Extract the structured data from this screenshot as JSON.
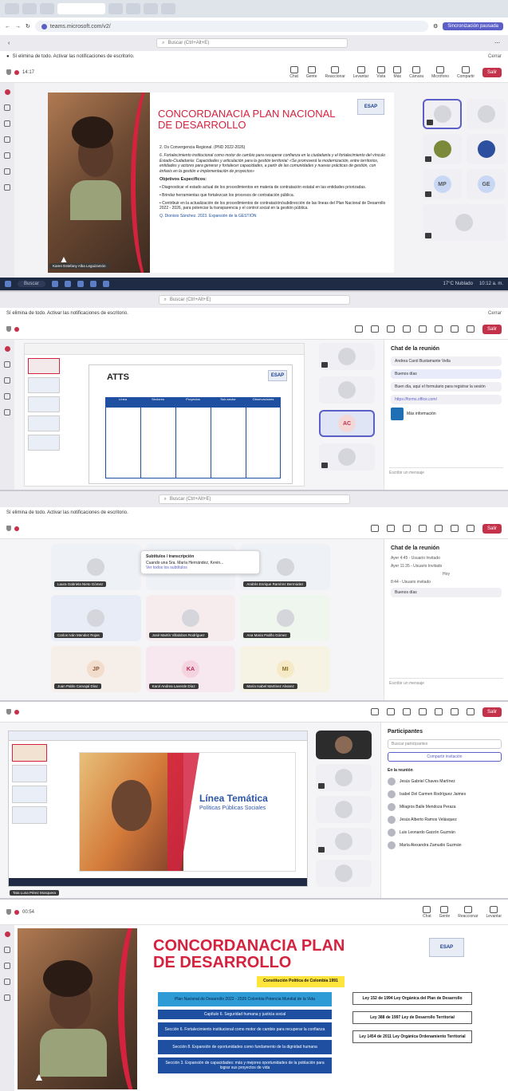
{
  "panel1": {
    "browser": {
      "url": "teams.microsoft.com/v2/",
      "profile_button": "Sincronización pausada"
    },
    "teams_search_placeholder": "Buscar (Ctrl+Alt+E)",
    "notification_banner": "Sí elimina de todo. Activar las notificaciones de escritorio.",
    "notification_close": "Cerrar",
    "meeting_timer": "14:17",
    "toolbar": [
      "Chat",
      "Gente",
      "Reaccionar",
      "Levantar",
      "Vista",
      "Más",
      "Cámara",
      "Micrófono",
      "Compartir"
    ],
    "leave_label": "Salir",
    "slide_title_line1": "CONCORDANACIA PLAN NACIONAL",
    "slide_title_line2": "DE DESARROLLO",
    "logo": "ESAP",
    "slide_body": {
      "line1": "2. Os Convergencia Regional. (PND 2022-2026)",
      "line2": "6. Fortalecimiento institucional como motor de cambio para recuperar confianza en la ciudadanía y el fortalecimiento del vínculo Estado-Ciudadanía: Capacidades y articulación para la gestión territorial: «Se promoverá la modernización, entre territorios, entidades y actores para generar y fortalecer capacidades, a partir de las comunidades y nuevas prácticas de gestión, con énfasis en la gestión e implementación de proyectos»",
      "objectives_heading": "Objetivos Específicos:",
      "bullets": [
        "Diagnosticar el estado actual de los procedimientos en materia de contratación estatal en las entidades priorizadas.",
        "Brindar herramientas que fortalezcan los procesos de contratación pública.",
        "Contribuir en la actualización de los procedimientos de contratación/subdirección de las líneas del Plan Nacional de Desarrollo 2022 - 2026, para potenciar la transparencia y el control social en la gestión pública."
      ]
    },
    "slide_footer": "Q. Dionisio Sánchez. 2023. Expansión de la GESTIÓN",
    "presenter_name": "Karen Estefany Alba Leguizamón",
    "taskbar_search": "Buscar",
    "taskbar_weather": "17°C Nublado",
    "taskbar_time": "10:12 a. m."
  },
  "panel2": {
    "chat_title": "Chat de la reunión",
    "chat_messages": [
      "Andrea Carol Bustamante Vella",
      "Buenos días",
      "Buen día, aquí el formulario para registrar la sesión",
      "https://forms.office.com/"
    ],
    "file_card": "Más información",
    "compose_placeholder": "Escribir un mensaje",
    "slide_title": "ATTS",
    "logo": "ESAP",
    "avatar_initials": "AC",
    "table_headers": [
      "Línea",
      "Sectores",
      "Proyectos",
      "Sub-sector",
      "Observaciones"
    ]
  },
  "panel3": {
    "chat_title": "Chat de la reunión",
    "chat_lines": [
      "Ayer 4:45 - Usuario Invitado",
      "Ayer 11:35 - Usuario Invitado",
      "Hoy",
      "8:44 - Usuario invitado",
      "Buenos días"
    ],
    "popup_title": "Subtítulos / transcripción",
    "popup_text": "Cuando una Sra. María Hernández, Kevin...",
    "popup_link": "Ver todos los subtítulos",
    "tiles": [
      {
        "initials": "",
        "name": "Laura Gabriela Nieto Gómez"
      },
      {
        "initials": "",
        "name": ""
      },
      {
        "initials": "",
        "name": "Andrés Enrique Ramírez Bermúdez"
      },
      {
        "initials": "",
        "name": "Carlos Iván Mendez Rojas"
      },
      {
        "initials": "",
        "name": "José Martín Villalobos Rodríguez"
      },
      {
        "initials": "",
        "name": "Ana Maria Patiño Gómez"
      },
      {
        "initials": "JP",
        "name": "Juan Pablo Carvajal Díaz"
      },
      {
        "initials": "KA",
        "name": "Karol Andrea Laverde Díaz"
      },
      {
        "initials": "MI",
        "name": "María Isabel Martínez Alvarez"
      }
    ],
    "compose_placeholder": "Escribir un mensaje"
  },
  "panel4": {
    "participants_title": "Participantes",
    "search_placeholder": "Buscar participantes",
    "share_button": "Compartir invitación",
    "in_meeting": "En la reunión",
    "participants": [
      "Jesús Gabriel Chaves Martínez",
      "Isabel Del Carmen Rodríguez Jaimes",
      "Milagros Balle Mendoza Peraza",
      "Jesús Alberto Ramos Velásquez",
      "Luis Leonardo Garzón Guzmán",
      "María Alexandra Zamudio Guzmán"
    ],
    "slide_title": "Línea Temática",
    "slide_subtitle": "Políticas Públicas Sociales",
    "presenter_name": "Tata Luna Pérez Mosquera"
  },
  "panel5": {
    "meeting_timer": "00:54",
    "toolbar": [
      "Chat",
      "Gente",
      "Reaccionar",
      "Levantar"
    ],
    "slide_title_line1": "CONCORDANACIA PLAN",
    "slide_title_line2": "DE DESARROLLO",
    "logo": "ESAP",
    "constitution_box": "Constitución Política de Colombia 1991",
    "pnd_box": "Plan Nacional de Desarrollo 2022 - 2026 Colombia Potencia Mundial de la Vida",
    "chapters": [
      "Capítulo 6. Seguridad humana y justicia social",
      "Sección 6. Fortalecimiento institucional como motor de cambio para recuperar la confianza",
      "Sección 8. Expansión de oportunidades como fundamento de la dignidad humana",
      "Sección 3. Expansión de capacidades: más y mejores oportunidades de la población para lograr sus proyectos de vida"
    ],
    "laws": [
      "Ley 152 de 1994 Ley Orgánica del Plan de Desarrollo",
      "Ley 388 de 1997 Ley de Desarrollo Territorial",
      "Ley 1454 de 2011 Ley Orgánica Ordenamiento Territorial"
    ]
  },
  "colors": {
    "accent_red": "#d4223f",
    "teams_purple": "#5b5fc7",
    "esap_blue": "#1e4fa0"
  }
}
